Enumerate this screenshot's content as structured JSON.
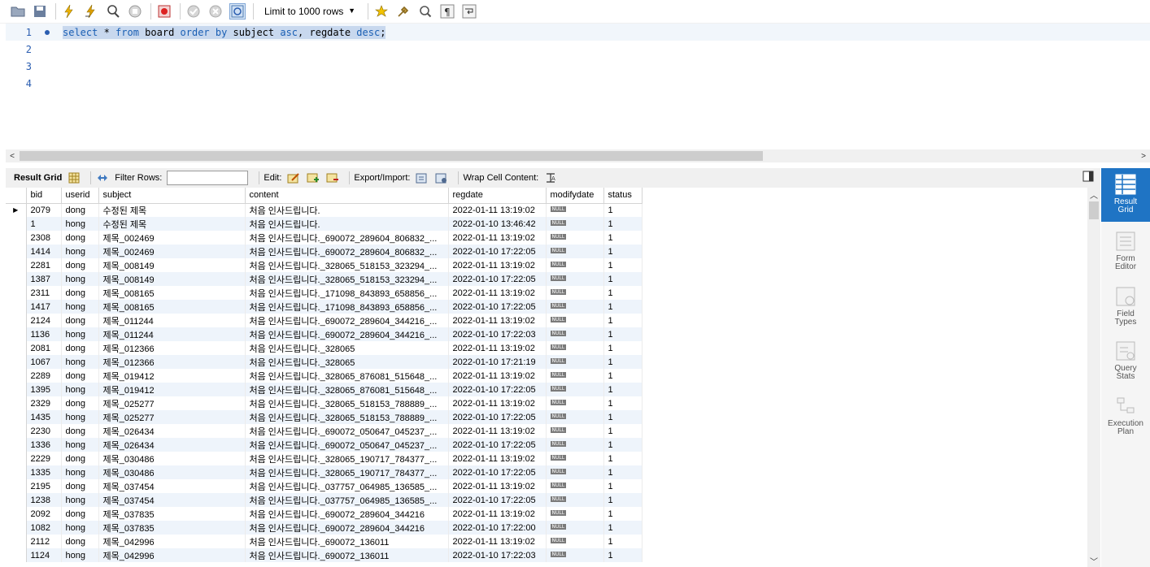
{
  "toolbar": {
    "limit_label": "Limit to 1000 rows"
  },
  "editor": {
    "lines": [
      {
        "no": "1",
        "sql": [
          {
            "t": "select",
            "k": true
          },
          {
            "t": " * ",
            "k": false
          },
          {
            "t": "from",
            "k": true
          },
          {
            "t": " board ",
            "k": false
          },
          {
            "t": "order by",
            "k": true
          },
          {
            "t": " subject ",
            "k": false
          },
          {
            "t": "asc",
            "k": true
          },
          {
            "t": ", regdate ",
            "k": false
          },
          {
            "t": "desc",
            "k": true
          },
          {
            "t": ";",
            "k": false
          }
        ]
      },
      {
        "no": "2",
        "sql": []
      },
      {
        "no": "3",
        "sql": []
      },
      {
        "no": "4",
        "sql": []
      }
    ]
  },
  "result_toolbar": {
    "result_grid_label": "Result Grid",
    "filter_rows_label": "Filter Rows:",
    "filter_value": "",
    "edit_label": "Edit:",
    "export_import_label": "Export/Import:",
    "wrap_cell_label": "Wrap Cell Content:"
  },
  "grid": {
    "columns": [
      "bid",
      "userid",
      "subject",
      "content",
      "regdate",
      "modifydate",
      "status"
    ],
    "null_label": "NULL",
    "rows": [
      [
        "2079",
        "dong",
        "수정된 제목",
        "처음 인사드립니다.",
        "2022-01-11 13:19:02",
        "NULL",
        "1"
      ],
      [
        "1",
        "hong",
        "수정된 제목",
        "처음 인사드립니다.",
        "2022-01-10 13:46:42",
        "NULL",
        "1"
      ],
      [
        "2308",
        "dong",
        "제목_002469",
        "처음 인사드립니다._690072_289604_806832_...",
        "2022-01-11 13:19:02",
        "NULL",
        "1"
      ],
      [
        "1414",
        "hong",
        "제목_002469",
        "처음 인사드립니다._690072_289604_806832_...",
        "2022-01-10 17:22:05",
        "NULL",
        "1"
      ],
      [
        "2281",
        "dong",
        "제목_008149",
        "처음 인사드립니다._328065_518153_323294_...",
        "2022-01-11 13:19:02",
        "NULL",
        "1"
      ],
      [
        "1387",
        "hong",
        "제목_008149",
        "처음 인사드립니다._328065_518153_323294_...",
        "2022-01-10 17:22:05",
        "NULL",
        "1"
      ],
      [
        "2311",
        "dong",
        "제목_008165",
        "처음 인사드립니다._171098_843893_658856_...",
        "2022-01-11 13:19:02",
        "NULL",
        "1"
      ],
      [
        "1417",
        "hong",
        "제목_008165",
        "처음 인사드립니다._171098_843893_658856_...",
        "2022-01-10 17:22:05",
        "NULL",
        "1"
      ],
      [
        "2124",
        "dong",
        "제목_011244",
        "처음 인사드립니다._690072_289604_344216_...",
        "2022-01-11 13:19:02",
        "NULL",
        "1"
      ],
      [
        "1136",
        "hong",
        "제목_011244",
        "처음 인사드립니다._690072_289604_344216_...",
        "2022-01-10 17:22:03",
        "NULL",
        "1"
      ],
      [
        "2081",
        "dong",
        "제목_012366",
        "처음 인사드립니다._328065",
        "2022-01-11 13:19:02",
        "NULL",
        "1"
      ],
      [
        "1067",
        "hong",
        "제목_012366",
        "처음 인사드립니다._328065",
        "2022-01-10 17:21:19",
        "NULL",
        "1"
      ],
      [
        "2289",
        "dong",
        "제목_019412",
        "처음 인사드립니다._328065_876081_515648_...",
        "2022-01-11 13:19:02",
        "NULL",
        "1"
      ],
      [
        "1395",
        "hong",
        "제목_019412",
        "처음 인사드립니다._328065_876081_515648_...",
        "2022-01-10 17:22:05",
        "NULL",
        "1"
      ],
      [
        "2329",
        "dong",
        "제목_025277",
        "처음 인사드립니다._328065_518153_788889_...",
        "2022-01-11 13:19:02",
        "NULL",
        "1"
      ],
      [
        "1435",
        "hong",
        "제목_025277",
        "처음 인사드립니다._328065_518153_788889_...",
        "2022-01-10 17:22:05",
        "NULL",
        "1"
      ],
      [
        "2230",
        "dong",
        "제목_026434",
        "처음 인사드립니다._690072_050647_045237_...",
        "2022-01-11 13:19:02",
        "NULL",
        "1"
      ],
      [
        "1336",
        "hong",
        "제목_026434",
        "처음 인사드립니다._690072_050647_045237_...",
        "2022-01-10 17:22:05",
        "NULL",
        "1"
      ],
      [
        "2229",
        "dong",
        "제목_030486",
        "처음 인사드립니다._328065_190717_784377_...",
        "2022-01-11 13:19:02",
        "NULL",
        "1"
      ],
      [
        "1335",
        "hong",
        "제목_030486",
        "처음 인사드립니다._328065_190717_784377_...",
        "2022-01-10 17:22:05",
        "NULL",
        "1"
      ],
      [
        "2195",
        "dong",
        "제목_037454",
        "처음 인사드립니다._037757_064985_136585_...",
        "2022-01-11 13:19:02",
        "NULL",
        "1"
      ],
      [
        "1238",
        "hong",
        "제목_037454",
        "처음 인사드립니다._037757_064985_136585_...",
        "2022-01-10 17:22:05",
        "NULL",
        "1"
      ],
      [
        "2092",
        "dong",
        "제목_037835",
        "처음 인사드립니다._690072_289604_344216",
        "2022-01-11 13:19:02",
        "NULL",
        "1"
      ],
      [
        "1082",
        "hong",
        "제목_037835",
        "처음 인사드립니다._690072_289604_344216",
        "2022-01-10 17:22:00",
        "NULL",
        "1"
      ],
      [
        "2112",
        "dong",
        "제목_042996",
        "처음 인사드립니다._690072_136011",
        "2022-01-11 13:19:02",
        "NULL",
        "1"
      ],
      [
        "1124",
        "hong",
        "제목_042996",
        "처음 인사드립니다._690072_136011",
        "2022-01-10 17:22:03",
        "NULL",
        "1"
      ]
    ]
  },
  "sidepanel": {
    "items": [
      {
        "label1": "Result",
        "label2": "Grid",
        "active": true
      },
      {
        "label1": "Form",
        "label2": "Editor",
        "active": false
      },
      {
        "label1": "Field",
        "label2": "Types",
        "active": false
      },
      {
        "label1": "Query",
        "label2": "Stats",
        "active": false
      },
      {
        "label1": "Execution",
        "label2": "Plan",
        "active": false
      }
    ]
  },
  "colors": {
    "accent": "#1f74c4",
    "keyword": "#1a5fb4",
    "selection": "#c8d8ee",
    "row_alt": "#eef4fb"
  }
}
